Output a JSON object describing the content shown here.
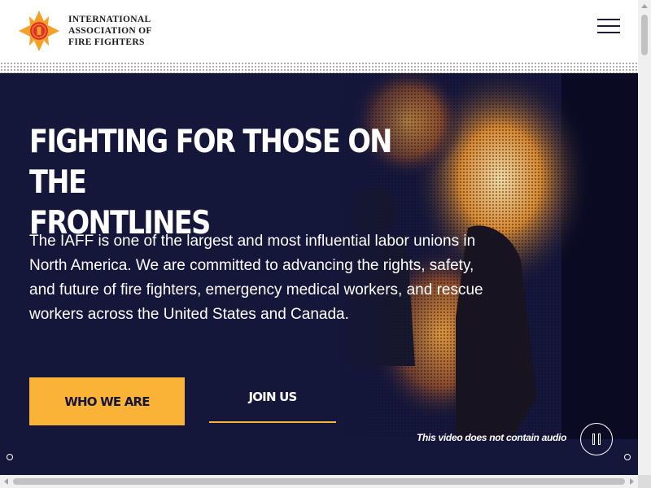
{
  "header": {
    "logo_icon": "iaff-maltese-cross-logo",
    "org_name_lines": [
      "INTERNATIONAL",
      "ASSOCIATION OF",
      "FIRE FIGHTERS"
    ],
    "menu_icon": "hamburger-menu-icon"
  },
  "hero": {
    "title_lines": [
      "FIGHTING FOR THOSE ON THE",
      "FRONTLINES"
    ],
    "description": "The IAFF is one of the largest and most influential labor unions in North America. We are committed to advancing the rights, safety, and future of fire fighters, emergency medical workers, and rescue workers across the United States and Canada.",
    "primary_button": "WHO WE ARE",
    "secondary_button": "JOIN US",
    "video_note": "This video does not contain audio",
    "pause_icon": "pause-icon"
  },
  "colors": {
    "navy": "#14163a",
    "accent": "#fbb337",
    "logo_red": "#e0312b",
    "logo_gold": "#f2a229"
  }
}
